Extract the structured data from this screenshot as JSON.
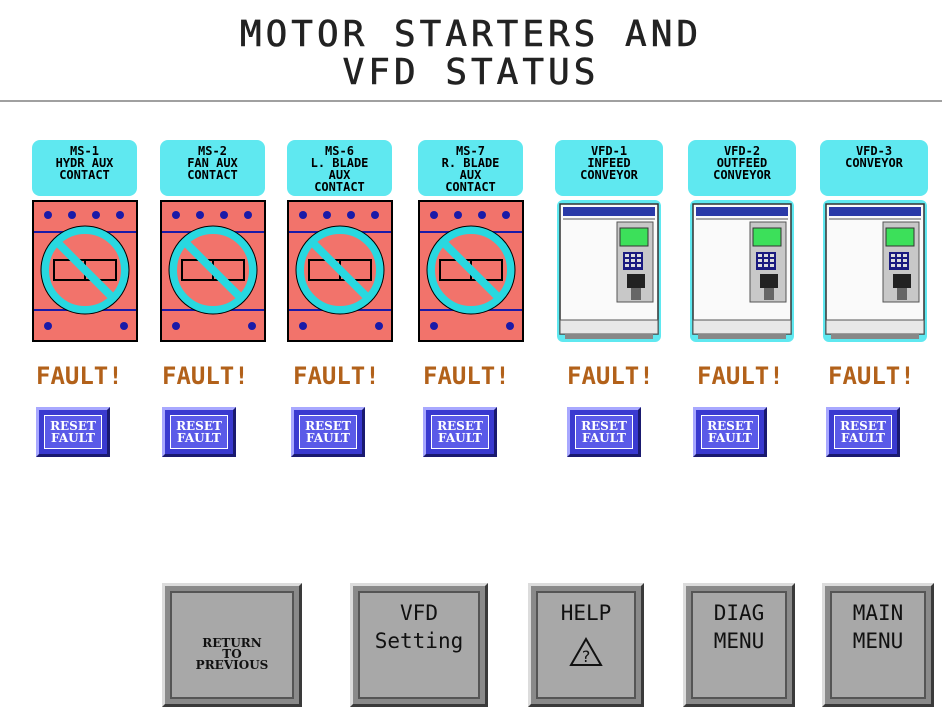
{
  "title": {
    "line1": "MOTOR STARTERS AND",
    "line2": "VFD STATUS"
  },
  "devices": [
    {
      "type": "starter",
      "label": [
        "MS-1",
        "HYDR AUX",
        "CONTACT"
      ],
      "status": "FAULT!",
      "reset": [
        "RESET",
        "FAULT"
      ]
    },
    {
      "type": "starter",
      "label": [
        "MS-2",
        "FAN AUX",
        "CONTACT"
      ],
      "status": "FAULT!",
      "reset": [
        "RESET",
        "FAULT"
      ]
    },
    {
      "type": "starter",
      "label": [
        "MS-6",
        "L. BLADE",
        "AUX",
        "CONTACT"
      ],
      "status": "FAULT!",
      "reset": [
        "RESET",
        "FAULT"
      ]
    },
    {
      "type": "starter",
      "label": [
        "MS-7",
        "R. BLADE",
        "AUX",
        "CONTACT"
      ],
      "status": "FAULT!",
      "reset": [
        "RESET",
        "FAULT"
      ]
    },
    {
      "type": "vfd",
      "label": [
        "VFD-1",
        "INFEED",
        "CONVEYOR"
      ],
      "status": "FAULT!",
      "reset": [
        "RESET",
        "FAULT"
      ]
    },
    {
      "type": "vfd",
      "label": [
        "VFD-2",
        "OUTFEED",
        "CONVEYOR"
      ],
      "status": "FAULT!",
      "reset": [
        "RESET",
        "FAULT"
      ]
    },
    {
      "type": "vfd",
      "label": [
        "VFD-3",
        "CONVEYOR"
      ],
      "status": "FAULT!",
      "reset": [
        "RESET",
        "FAULT"
      ]
    }
  ],
  "nav": [
    {
      "lines": [
        "RETURN",
        "TO",
        "PREVIOUS"
      ],
      "style": "small"
    },
    {
      "lines": [
        "VFD",
        "Setting"
      ],
      "style": "normal"
    },
    {
      "lines": [
        "HELP"
      ],
      "style": "normal",
      "icon": "help-warning-icon",
      "icon_text": "?"
    },
    {
      "lines": [
        "DIAG",
        "MENU"
      ],
      "style": "normal"
    },
    {
      "lines": [
        "MAIN",
        "MENU"
      ],
      "style": "normal"
    }
  ],
  "colors": {
    "label_bg": "#5fe8f0",
    "starter_body": "#f2736b",
    "fault_text": "#b2611a",
    "reset_button": "#3a3ad0",
    "nav_button": "#a8a8a8"
  }
}
